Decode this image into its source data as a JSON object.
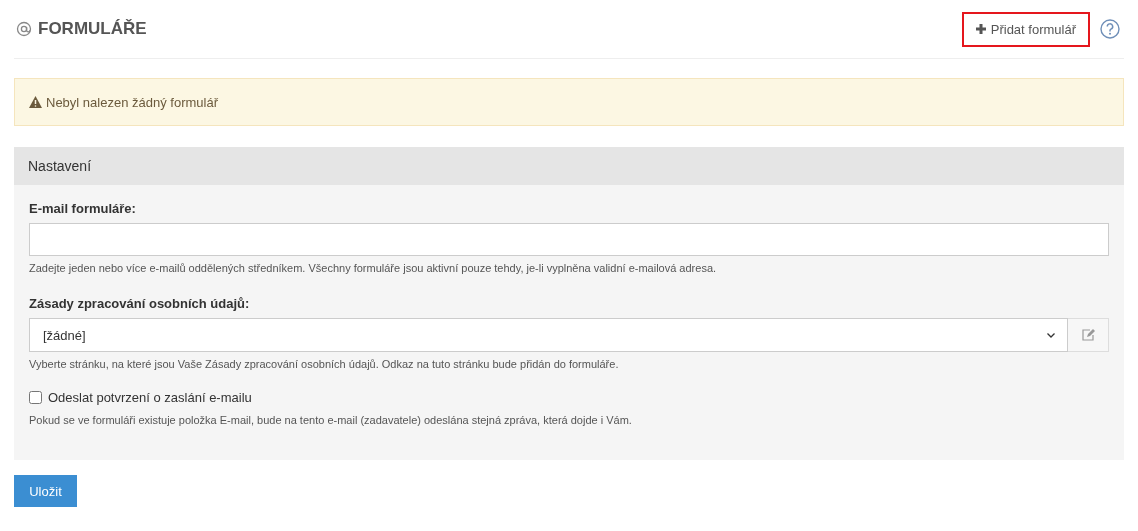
{
  "header": {
    "title": "FORMULÁŘE",
    "add_button": "Přidat formulář"
  },
  "alert": {
    "text": "Nebyl nalezen žádný formulář"
  },
  "panel": {
    "title": "Nastavení",
    "email_field": {
      "label": "E-mail formuláře:",
      "help": "Zadejte jeden nebo více e-mailů oddělených středníkem. Všechny formuláře jsou aktivní pouze tehdy, je-li vyplněna validní e-mailová adresa."
    },
    "policy_field": {
      "label": "Zásady zpracování osobních údajů:",
      "value": "[žádné]",
      "help": "Vyberte stránku, na které jsou Vaše Zásady zpracování osobních údajů. Odkaz na tuto stránku bude přidán do formuláře."
    },
    "confirm_checkbox": {
      "label": "Odeslat potvrzení o zaslání e-mailu",
      "checked": false,
      "help": "Pokud se ve formuláři existuje položka E-mail, bude na tento e-mail (zadavatele) odeslána stejná zpráva, která dojde i Vám."
    }
  },
  "save_button": "Uložit"
}
